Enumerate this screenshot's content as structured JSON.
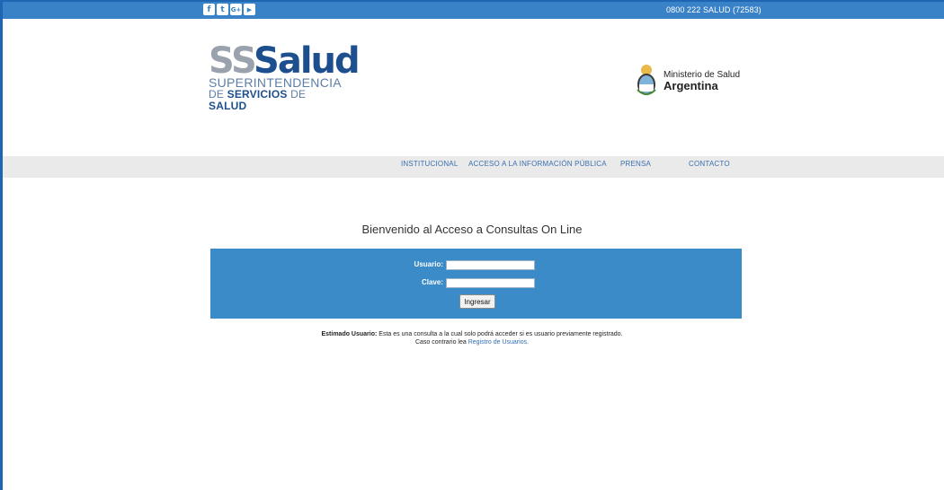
{
  "top_bar": {
    "social": [
      {
        "icon": "facebook-icon",
        "glyph": "f"
      },
      {
        "icon": "twitter-icon",
        "glyph": "t"
      },
      {
        "icon": "google-plus-icon",
        "glyph": "G+"
      },
      {
        "icon": "youtube-icon",
        "glyph": "▶"
      }
    ],
    "phone": "0800 222 SALUD (72583)"
  },
  "logo": {
    "main_ss": "SS",
    "main_word": "Salud",
    "line1": "SUPERINTENDENCIA",
    "line2_prefix": "DE",
    "line2_bold": "SERVICIOS",
    "line2_mid": "DE",
    "line2_end": "SALUD"
  },
  "ministry": {
    "line1": "Ministerio de Salud",
    "line2": "Argentina"
  },
  "nav": {
    "items": [
      "INSTITUCIONAL",
      "ACCESO A LA INFORMACIÓN PÚBLICA",
      "PRENSA",
      "CONTACTO"
    ]
  },
  "welcome_text": "Bienvenido al Acceso a Consultas On Line",
  "login": {
    "user_label": "Usuario:",
    "user_value": "",
    "password_label": "Clave:",
    "password_value": "",
    "submit_label": "Ingresar"
  },
  "notice": {
    "bold": "Estimado Usuario:",
    "text": "Esta es una consulta a la cual solo podrá acceder si es usuario previamente registrado.",
    "line2_prefix": "Caso contrario lea",
    "link": "Registro de Usuarios."
  },
  "colors": {
    "top_bar": "#3a82c7",
    "login_box": "#3a8bc8",
    "nav_bg": "#eaeaea",
    "link": "#2f6fb5"
  }
}
